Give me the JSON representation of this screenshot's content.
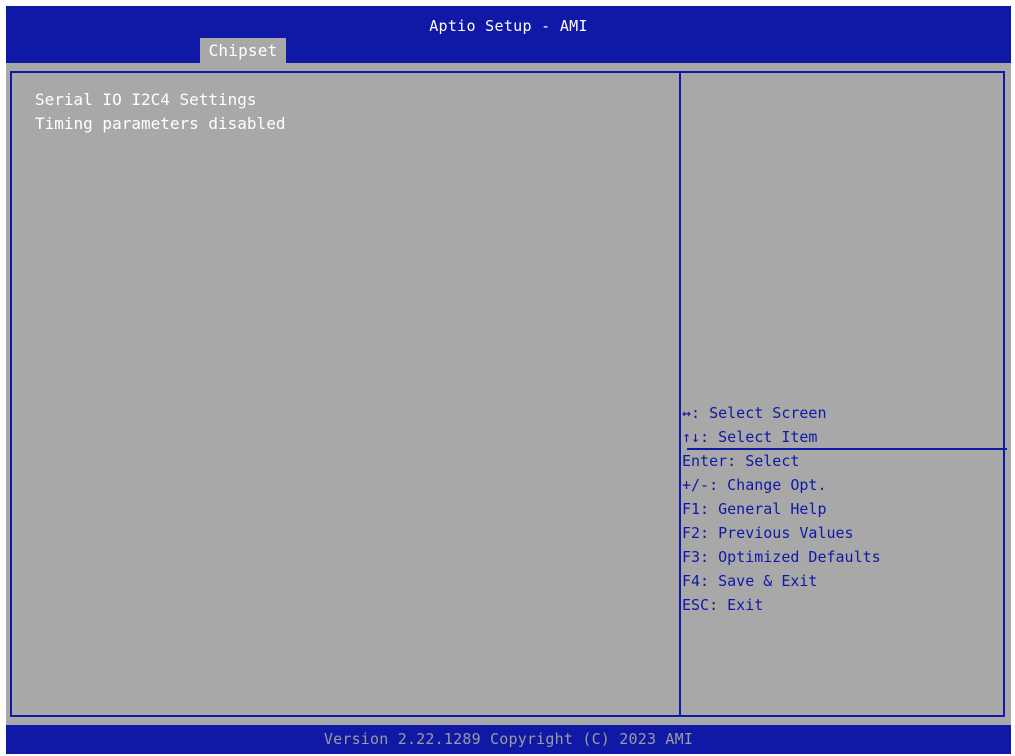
{
  "header": {
    "title": "Aptio Setup - AMI",
    "active_tab": "Chipset"
  },
  "main": {
    "lines": [
      "Serial IO I2C4 Settings",
      "Timing parameters disabled"
    ]
  },
  "help": {
    "items": [
      "↔: Select Screen",
      "↑↓: Select Item",
      "Enter: Select",
      "+/-: Change Opt.",
      "F1: General Help",
      "F2: Previous Values",
      "F3: Optimized Defaults",
      "F4: Save & Exit",
      "ESC: Exit"
    ]
  },
  "footer": {
    "version_text": "Version 2.22.1289 Copyright (C) 2023 AMI"
  },
  "colors": {
    "header_blue": "#1018a6",
    "panel_gray": "#a8a8a8",
    "text_white": "#ffffff",
    "help_text_blue": "#1018a6",
    "footer_text_gray": "#9c9c9c"
  }
}
